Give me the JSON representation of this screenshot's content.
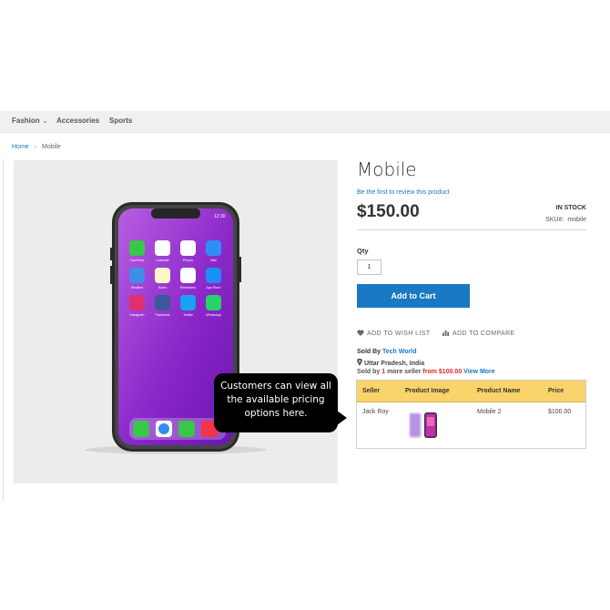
{
  "nav": {
    "items": [
      {
        "label": "Fashion",
        "has_dropdown": true
      },
      {
        "label": "Accessories"
      },
      {
        "label": "Sports"
      }
    ]
  },
  "breadcrumb": {
    "home": "Home",
    "separator": "›",
    "current": "Mobile"
  },
  "gallery": {
    "phone_apps": [
      {
        "label": "FaceTime",
        "icon": "facetime-icon",
        "color": "#37c84a"
      },
      {
        "label": "Calendar",
        "icon": "calendar-icon",
        "color": "#ffffff"
      },
      {
        "label": "Photos",
        "icon": "photos-icon",
        "color": "#ffffff"
      },
      {
        "label": "Mail",
        "icon": "mail-icon",
        "color": "#2f8ef5"
      },
      {
        "label": "Weather",
        "icon": "weather-icon",
        "color": "#3d8ee8"
      },
      {
        "label": "Notes",
        "icon": "notes-icon",
        "color": "#fff6c8"
      },
      {
        "label": "Reminders",
        "icon": "reminders-icon",
        "color": "#ffffff"
      },
      {
        "label": "App Store",
        "icon": "app-store-icon",
        "color": "#1c8ef5"
      },
      {
        "label": "Instagram",
        "icon": "instagram-icon",
        "color": "#e1306c"
      },
      {
        "label": "Facebook",
        "icon": "facebook-icon",
        "color": "#3b5998"
      },
      {
        "label": "Twitter",
        "icon": "twitter-icon",
        "color": "#1da1f2"
      },
      {
        "label": "WhatsApp",
        "icon": "whatsapp-icon",
        "color": "#25d366"
      }
    ],
    "phone_time": "12:30"
  },
  "product": {
    "title": "Mobile",
    "review_link": "Be the first to review this product",
    "price": "$150.00",
    "stock": "IN STOCK",
    "sku_label": "SKU#:",
    "sku_value": "mobile",
    "qty_label": "Qty",
    "qty_value": "1",
    "add_to_cart": "Add to Cart",
    "wishlist": "ADD TO WISH LIST",
    "compare": "ADD TO COMPARE"
  },
  "seller": {
    "sold_by_label": "Sold By",
    "store_name": "Tech World",
    "location": "Uttar Pradesh, India",
    "more_prefix": "Sold by",
    "more_count": "1",
    "more_mid": "more seller",
    "more_from": "from $100.00",
    "view_more": "View More",
    "table": {
      "headers": [
        "Seller",
        "Product Image",
        "Product Name",
        "Price"
      ],
      "rows": [
        {
          "seller": "Jack Roy",
          "product_name": "Mobile 2",
          "price": "$100.00"
        }
      ]
    }
  },
  "tooltip": {
    "line1": "Customers can view all",
    "line2": "the available pricing",
    "line3": "options here."
  },
  "colors": {
    "accent": "#1979c3",
    "table_header": "#fad46b",
    "highlight": "#e02b27"
  }
}
